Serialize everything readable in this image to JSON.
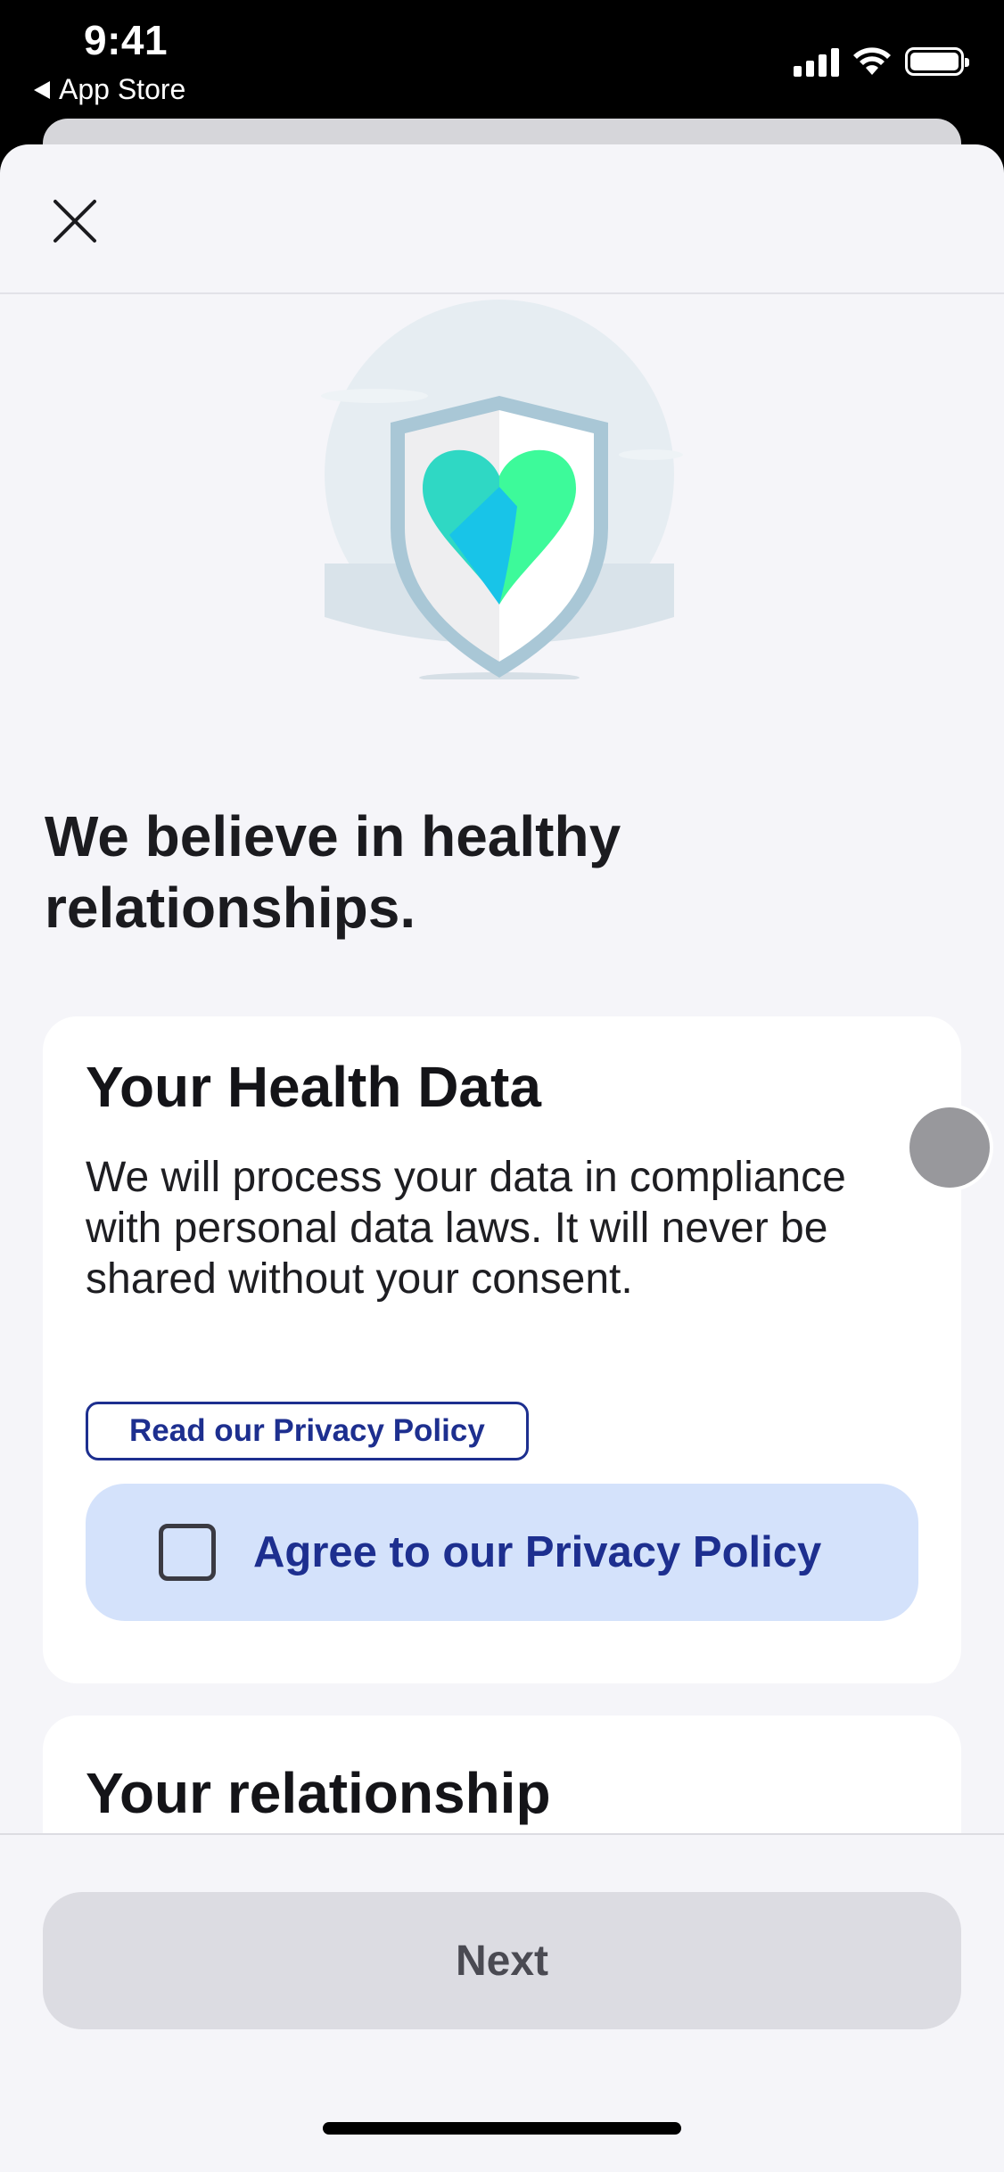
{
  "status_bar": {
    "time": "9:41",
    "back_app": "App Store",
    "icons": [
      "cellular-signal-icon",
      "wifi-icon",
      "battery-icon"
    ]
  },
  "nav": {
    "close_icon": "close-icon"
  },
  "hero": {
    "illustration": "shield-heart-illustration",
    "colors": {
      "heart_left": "#2fd8c4",
      "heart_right": "#3dfa9a",
      "heart_center": "#18c4e8",
      "shield_border": "#a9c7d6"
    }
  },
  "headline": "We believe in healthy relationships.",
  "health_card": {
    "title": "Your Health Data",
    "body": "We will process your data in compliance with personal data laws. It will never be shared without your consent.",
    "privacy_link": "Read our Privacy Policy",
    "agree_label": "Agree to our Privacy Policy",
    "agree_checked": false
  },
  "relationship_card": {
    "title": "Your relationship"
  },
  "footer": {
    "next_label": "Next"
  },
  "colors": {
    "accent": "#1d2f8f",
    "agree_bg": "#d4e2fb",
    "background": "#f5f5f9",
    "button_disabled": "#dcdce2"
  }
}
